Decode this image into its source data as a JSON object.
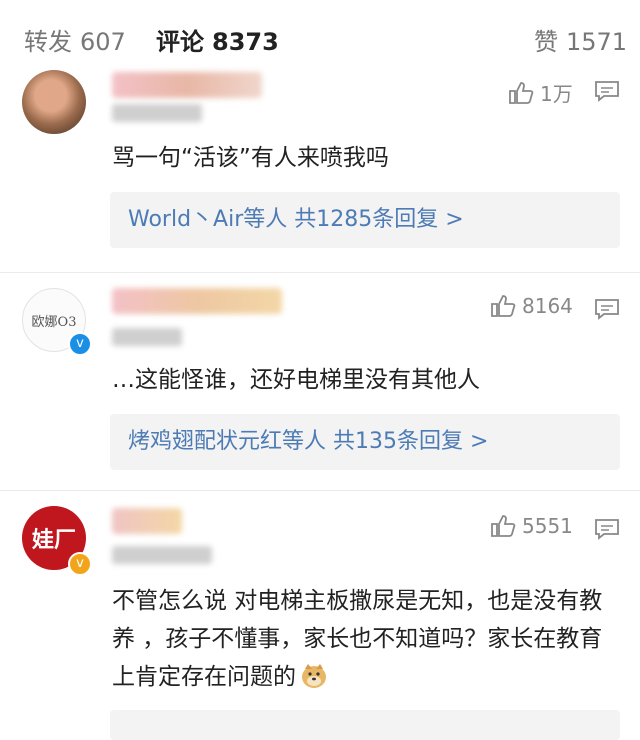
{
  "tabs": [
    {
      "label": "转发",
      "count": "607"
    },
    {
      "label": "评论",
      "count": "8373"
    },
    {
      "label": "赞",
      "count": "1571"
    }
  ],
  "comments": [
    {
      "likes": "1万",
      "text": "骂一句“活该”有人来喷我吗",
      "replies": "World丶Air等人 共1285条回复 >"
    },
    {
      "avatar_text": "欧娜O3",
      "likes": "8164",
      "text": "…这能怪谁，还好电梯里没有其他人",
      "replies": "烤鸡翅配状元红等人 共135条回复 >"
    },
    {
      "avatar_text": "娃厂",
      "likes": "5551",
      "text": "不管怎么说 对电梯主板撒尿是无知，也是没有教养 ，孩子不懂事，家长也不知道吗？家长在教育上肯定存在问题的"
    }
  ],
  "icons": {
    "like": "thumbs-up-icon",
    "comment": "comment-bubble-icon",
    "verified": "verified-v-icon",
    "emoji": "doge-emoji-icon"
  },
  "colors": {
    "link": "#4c7bb5",
    "verified_blue": "#1a8fe6",
    "verified_gold": "#f2a51a"
  }
}
